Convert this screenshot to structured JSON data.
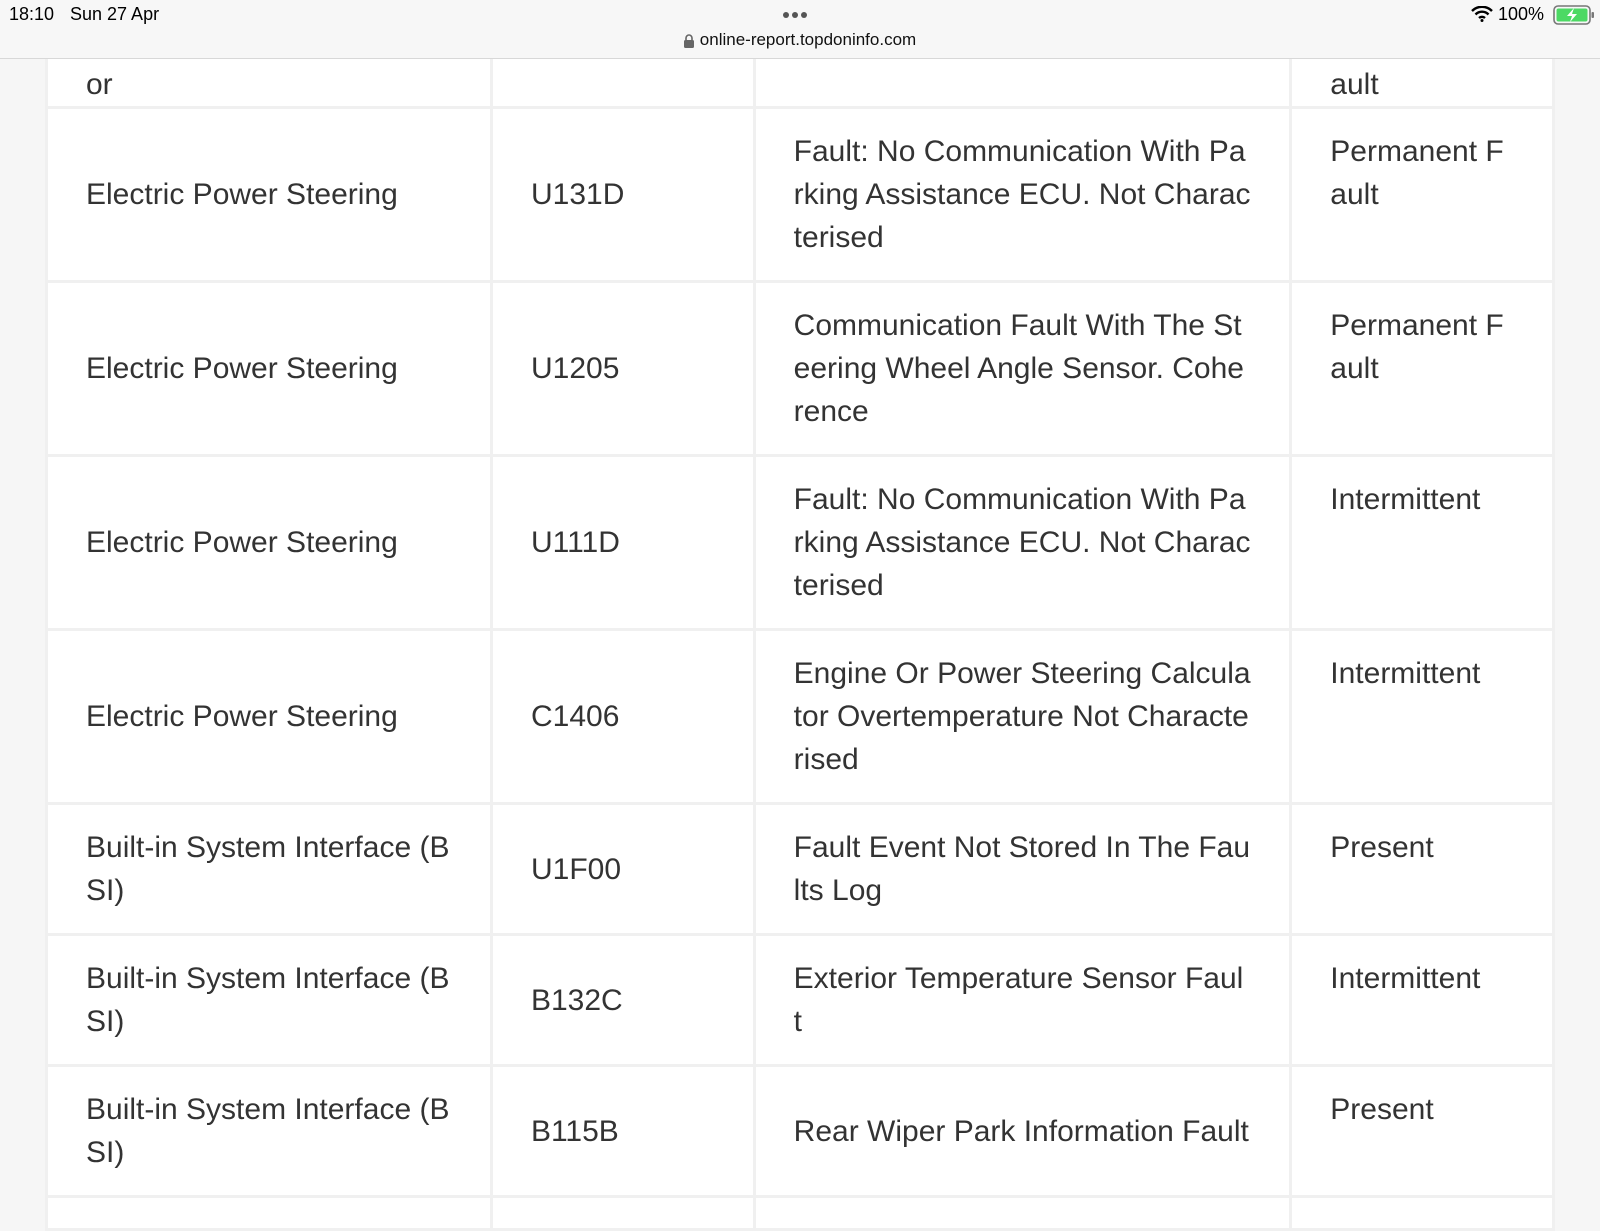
{
  "status_bar": {
    "time": "18:10",
    "date": "Sun 27 Apr",
    "battery": "100%",
    "icons": [
      "wifi-icon",
      "battery-charging-icon",
      "more-dots-icon",
      "lock-icon"
    ]
  },
  "browser": {
    "url": "online-report.topdoninfo.com"
  },
  "colors": {
    "page_bg": "#f6f6f6",
    "table_bg": "#ffffff",
    "border": "#f0f0f0",
    "text": "#333333",
    "battery_green": "#4cd964"
  },
  "table": {
    "partial_row": {
      "system": "or",
      "code": "",
      "description": "",
      "status": "ault"
    },
    "rows": [
      {
        "system": "Electric Power Steering",
        "code": "U131D",
        "description": "Fault: No Communication With Parking Assistance ECU. Not Characterised",
        "status": "Permanent Fault"
      },
      {
        "system": "Electric Power Steering",
        "code": "U1205",
        "description": "Communication Fault With The Steering Wheel Angle Sensor. Coherence",
        "status": "Permanent Fault"
      },
      {
        "system": "Electric Power Steering",
        "code": "U111D",
        "description": "Fault: No Communication With Parking Assistance ECU. Not Characterised",
        "status": "Intermittent"
      },
      {
        "system": "Electric Power Steering",
        "code": "C1406",
        "description": "Engine Or Power Steering Calculator Overtemperature Not Characterised",
        "status": "Intermittent"
      },
      {
        "system": "Built-in System Interface (BSI)",
        "code": "U1F00",
        "description": "Fault Event Not Stored In The Faults Log",
        "status": "Present"
      },
      {
        "system": "Built-in System Interface (BSI)",
        "code": "B132C",
        "description": "Exterior Temperature Sensor Fault",
        "status": "Intermittent"
      },
      {
        "system": "Built-in System Interface (BSI)",
        "code": "B115B",
        "description": "Rear Wiper Park Information Fault",
        "status": "Present"
      }
    ]
  }
}
